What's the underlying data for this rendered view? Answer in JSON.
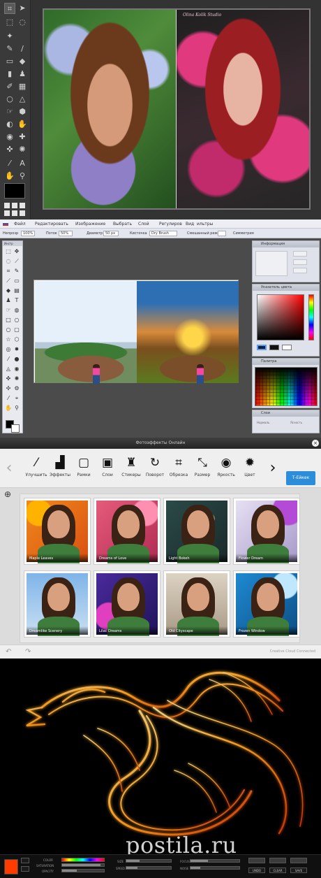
{
  "panel1": {
    "signature": "Olina Kolik Studio"
  },
  "panel2": {
    "menu": [
      "Файл",
      "Редактировать",
      "Изображение",
      "Выбрать",
      "Слой",
      "Регулиров",
      "Вид",
      "ильтры"
    ],
    "options": {
      "opacity_label": "Непрозр",
      "opacity_value": "100%",
      "flow_label": "Поток",
      "flow_value": "50%",
      "diameter_label": "Диаметр",
      "diameter_value": "50 px",
      "brush_label": "Кисточка",
      "brush_value": "Dry Brush",
      "blend_label": "Смешанный режи",
      "symmetry_label": "Симметрия"
    },
    "tools_title": "Инстр",
    "info_title": "Информация",
    "color_title": "Указатель цвета",
    "palette_title": "Палитра",
    "layers_title": "Слои",
    "layers_row_left": "Нормаль",
    "layers_row_right": "Ясность"
  },
  "panel3": {
    "title": "Фотоэффекты Онлайн",
    "tools": [
      {
        "label": "Улучшить",
        "icon": "magic-wand-icon"
      },
      {
        "label": "Эффекты",
        "icon": "effects-icon"
      },
      {
        "label": "Рамки",
        "icon": "frame-icon"
      },
      {
        "label": "Слои",
        "icon": "layers-icon"
      },
      {
        "label": "Стикеры",
        "icon": "hat-icon"
      },
      {
        "label": "Поворот",
        "icon": "rotate-icon"
      },
      {
        "label": "Обрезка",
        "icon": "crop-icon"
      },
      {
        "label": "Размер",
        "icon": "resize-icon"
      },
      {
        "label": "Яркость",
        "icon": "brightness-icon"
      },
      {
        "label": "Цвет",
        "icon": "color-icon"
      }
    ],
    "main_button": "Т-Ейкек",
    "thumbs": [
      "Maple Leaves",
      "Dreams of Love",
      "Light Bokeh",
      "Flower Dream",
      "Dreamlike Scenery",
      "Lilac Dreams",
      "Old Cityscape",
      "Frozen Window"
    ],
    "footer_cc": "Creative Cloud Connected"
  },
  "panel4": {
    "watermark": "postila.ru",
    "labels": {
      "color": "COLOR",
      "saturation": "SATURATION",
      "opacity": "OPACITY",
      "size": "SIZE",
      "speed": "SPEED",
      "focus": "FOCUS",
      "noise": "NOISE",
      "undo": "UNDO",
      "clear": "CLEAR",
      "save": "SAVE"
    },
    "slider_values": {
      "saturation": 0.92,
      "opacity": 0.35,
      "size": 0.3,
      "speed": 0.25,
      "focus": 0.35,
      "noise": 0.2
    },
    "accent_color": "#ff3c00"
  }
}
